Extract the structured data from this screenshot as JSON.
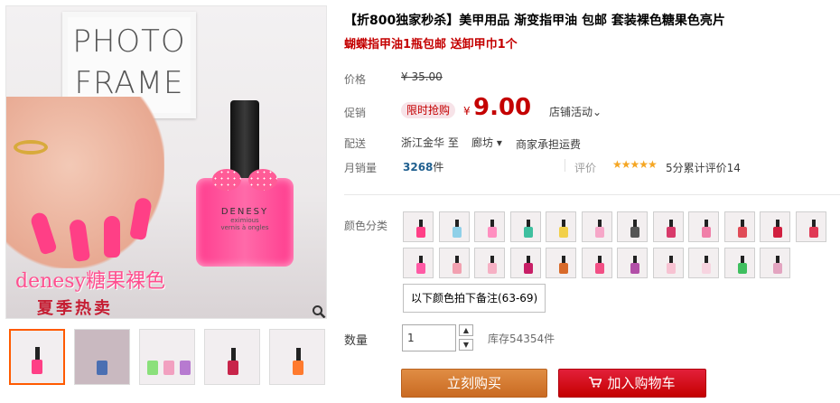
{
  "gallery": {
    "frame_text_line1": "PHOTO",
    "frame_text_line2": "FRAME",
    "bottle_brand": "DENESY",
    "bottle_sub": "eximious",
    "bottle_sub2": "vernis à ongles",
    "caption1": "denesy糖果裸色",
    "caption2": "夏季热卖",
    "zoom_icon": "magnifier-icon",
    "thumbs": [
      {
        "active": true,
        "color": "#ff3f86"
      },
      {
        "active": false,
        "color": "#4a6fb2"
      },
      {
        "active": false,
        "color": "#8be07b"
      },
      {
        "active": false,
        "color": "#c8244a"
      },
      {
        "active": false,
        "color": "#ff7a2e"
      }
    ]
  },
  "product": {
    "title": "【折800独家秒杀】美甲用品 渐变指甲油 包邮 套装裸色糖果色亮片",
    "subtitle": "蝴蝶指甲油1瓶包邮 送卸甲巾1个"
  },
  "price": {
    "label": "价格",
    "original": "¥ 35.00",
    "promo_label": "促销",
    "promo_tag": "限时抢购",
    "currency": "¥",
    "current": "9.00",
    "shop_promo": "店铺活动⌄"
  },
  "shipping": {
    "label": "配送",
    "from": "浙江金华 至",
    "to": "廊坊 ▾",
    "fee": "商家承担运费"
  },
  "sales": {
    "label": "月销量",
    "count": "3268",
    "unit": "件",
    "review_label": "评价",
    "stars": "★★★★★",
    "review_text": "5分累计评价14"
  },
  "colors": {
    "label": "颜色分类",
    "swatches": [
      "#ff3f86",
      "#8fd0e8",
      "#ff8fc0",
      "#3fbf9f",
      "#f2d04a",
      "#f6a7c8",
      "#555555",
      "#d83a6a",
      "#f07fa8",
      "#e04b57",
      "#d11f3f",
      "#e03a55",
      "#ff5aa5",
      "#f2a0b0",
      "#f6b0c4",
      "#c81e66",
      "#d86a2a",
      "#f24f85",
      "#b24fa8",
      "#f7c2d2",
      "#f7d4e0",
      "#3fbf5f",
      "#e3a4c0"
    ],
    "note_option": "以下颜色拍下备注(63-69)"
  },
  "quantity": {
    "label": "数量",
    "value": "1",
    "up": "▲",
    "down": "▼",
    "stock": "库存54354件"
  },
  "actions": {
    "buy_now": "立刻购买",
    "cart_icon": "cart-icon",
    "add_to_cart": "加入购物车"
  }
}
